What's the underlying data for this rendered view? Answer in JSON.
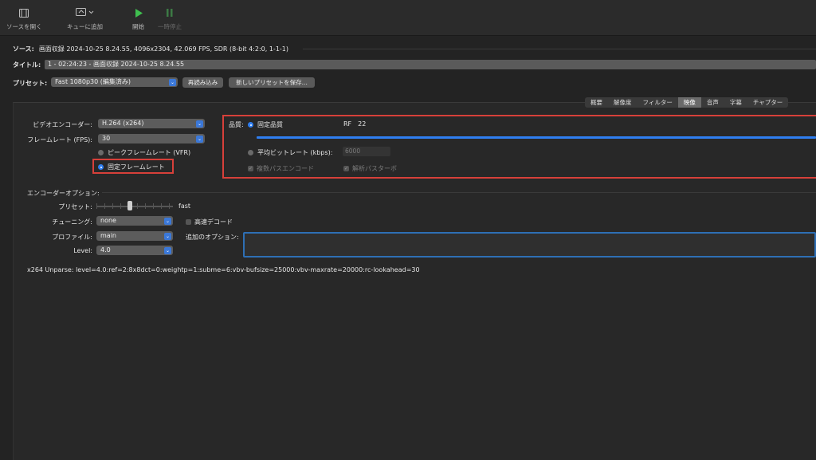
{
  "toolbar": {
    "open_source": "ソースを開く",
    "add_queue": "キューに追加",
    "start": "開始",
    "pause": "一時停止"
  },
  "source": {
    "label": "ソース:",
    "value": "画面収録 2024-10-25 8.24.55, 4096x2304, 42.069 FPS, SDR (8-bit 4:2:0, 1-1-1)"
  },
  "title": {
    "label": "タイトル:",
    "value": "1 - 02:24:23 - 画面収録 2024-10-25 8.24.55"
  },
  "preset": {
    "label": "プリセット:",
    "value": "Fast 1080p30 (編集済み)",
    "reload": "再読み込み",
    "save_new": "新しいプリセットを保存..."
  },
  "tabs": [
    "概要",
    "解像度",
    "フィルター",
    "映像",
    "音声",
    "字幕",
    "チャプター"
  ],
  "active_tab": "映像",
  "video": {
    "encoder_label": "ビデオエンコーダー:",
    "encoder_value": "H.264 (x264)",
    "framerate_label": "フレームレート (FPS):",
    "framerate_value": "30",
    "peak_vfr": "ピークフレームレート (VFR)",
    "constant": "固定フレームレート"
  },
  "quality": {
    "label": "品質:",
    "constant_quality": "固定品質",
    "rf_label": "RF",
    "rf_value": "22",
    "avg_bitrate": "平均ビットレート (kbps):",
    "bitrate_value": "6000",
    "multipass": "複数パスエンコード",
    "turbo": "解析パスターボ"
  },
  "encoder_options": {
    "header": "エンコーダーオプション:",
    "preset_label": "プリセット:",
    "preset_value": "fast",
    "tune_label": "チューニング:",
    "tune_value": "none",
    "fast_decode": "高速デコード",
    "profile_label": "プロファイル:",
    "profile_value": "main",
    "extra_label": "追加のオプション:",
    "level_label": "Level:",
    "level_value": "4.0"
  },
  "unparse": "x264 Unparse: level=4.0:ref=2:8x8dct=0:weightp=1:subme=6:vbv-bufsize=25000:vbv-maxrate=20000:rc-lookahead=30",
  "colors": {
    "accent": "#2f7ef0",
    "highlight_box": "#d7403a",
    "start_green": "#3fbf4f"
  }
}
